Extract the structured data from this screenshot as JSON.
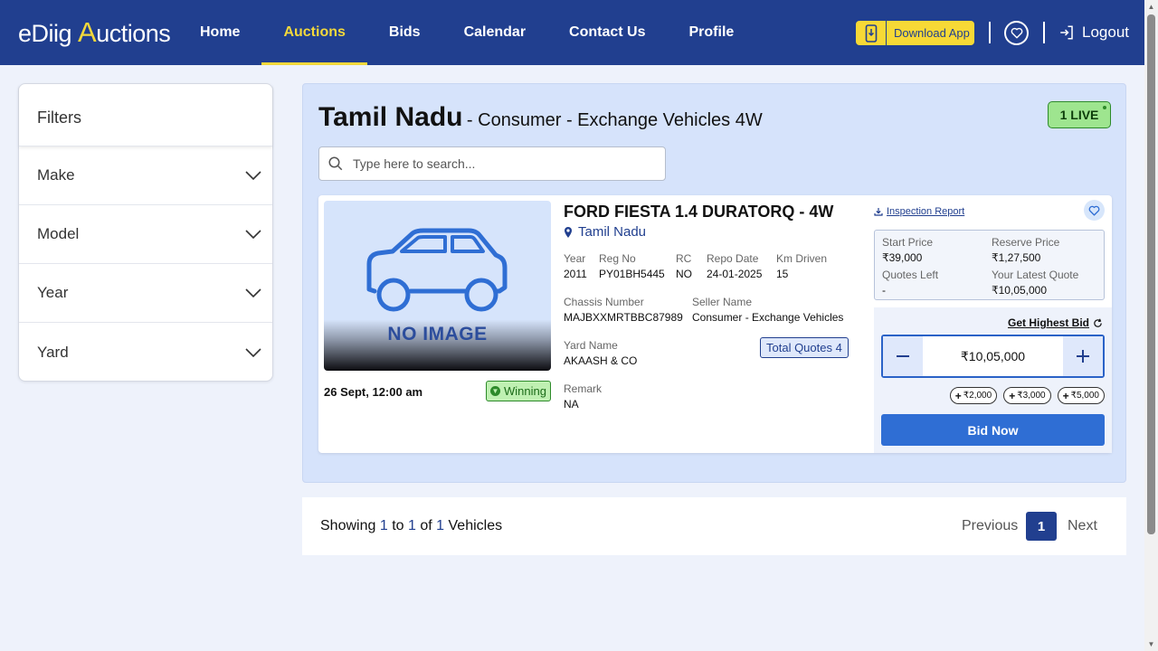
{
  "brand": {
    "logo_prefix": "eDiig ",
    "logo_a": "A",
    "logo_rest": "uctions"
  },
  "nav": {
    "items": [
      "Home",
      "Auctions",
      "Bids",
      "Calendar",
      "Contact Us",
      "Profile"
    ],
    "active": "Auctions"
  },
  "header": {
    "download_label": "Download App",
    "logout_label": "Logout"
  },
  "filters": {
    "title": "Filters",
    "items": [
      "Make",
      "Model",
      "Year",
      "Yard"
    ]
  },
  "page": {
    "region": "Tamil Nadu",
    "subtitle": "- Consumer - Exchange Vehicles 4W",
    "live_badge": "1 LIVE"
  },
  "search": {
    "placeholder": "Type here to search..."
  },
  "vehicle": {
    "image_text": "NO IMAGE",
    "end_time": "26 Sept, 12:00 am",
    "status": "Winning",
    "name": "FORD FIESTA 1.4 DURATORQ - 4W",
    "location": "Tamil Nadu",
    "year_label": "Year",
    "year": "2011",
    "reg_label": "Reg No",
    "reg": "PY01BH5445",
    "rc_label": "RC",
    "rc": "NO",
    "repo_label": "Repo Date",
    "repo": "24-01-2025",
    "km_label": "Km Driven",
    "km": "15",
    "chassis_label": "Chassis Number",
    "chassis": "MAJBXXMRTBBC87989",
    "seller_label": "Seller Name",
    "seller": "Consumer - Exchange Vehicles",
    "yard_label": "Yard Name",
    "yard": "AKAASH & CO",
    "total_quotes": "Total Quotes 4",
    "remark_label": "Remark",
    "remark": "NA"
  },
  "pricing": {
    "inspection_label": "Inspection Report",
    "start_label": "Start Price",
    "start": "₹39,000",
    "reserve_label": "Reserve Price",
    "reserve": "₹1,27,500",
    "quotes_left_label": "Quotes Left",
    "quotes_left": "-",
    "latest_label": "Your Latest Quote",
    "latest": "₹10,05,000",
    "highest_label": "Get Highest Bid",
    "bid_value": "₹10,05,000",
    "increments": [
      "₹2,000",
      "₹3,000",
      "₹5,000"
    ],
    "bid_button": "Bid Now"
  },
  "pagination": {
    "showing": "Showing",
    "from": "1",
    "to_word": "to",
    "to": "1",
    "of_word": "of",
    "total": "1",
    "unit": "Vehicles",
    "prev": "Previous",
    "page": "1",
    "next": "Next"
  },
  "colors": {
    "header_bg": "#213f8f",
    "accent_yellow": "#f3d83b",
    "primary_blue": "#2f6ed4",
    "live_green": "#9ee58f"
  }
}
